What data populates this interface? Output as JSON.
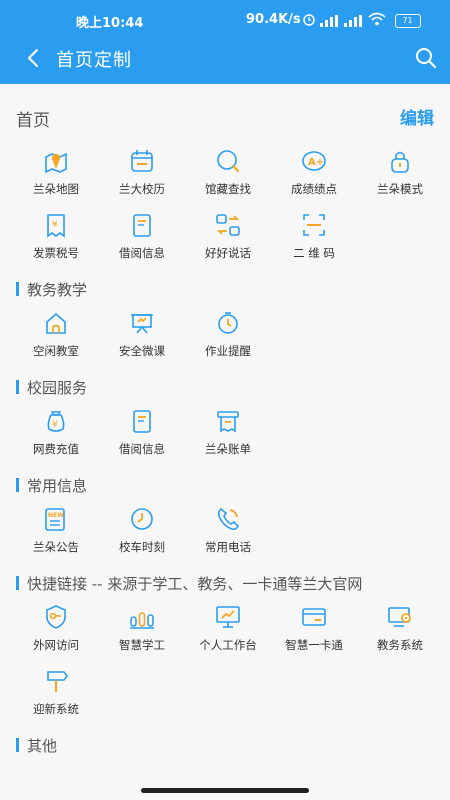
{
  "status_bar": {
    "time": "晚上10:44",
    "network_speed": "90.4K/s",
    "battery": "71"
  },
  "header": {
    "title": "首页定制"
  },
  "home": {
    "title": "首页",
    "edit_label": "编辑",
    "items": [
      {
        "label": "兰朵地图",
        "icon": "map-pin-icon"
      },
      {
        "label": "兰大校历",
        "icon": "calendar-icon"
      },
      {
        "label": "馆藏查找",
        "icon": "search-book-icon"
      },
      {
        "label": "成绩绩点",
        "icon": "grade-icon"
      },
      {
        "label": "兰朵模式",
        "icon": "lock-icon"
      },
      {
        "label": "发票税号",
        "icon": "invoice-icon"
      },
      {
        "label": "借阅信息",
        "icon": "book-icon"
      },
      {
        "label": "好好说话",
        "icon": "swap-icon"
      },
      {
        "label": "二 维 码",
        "icon": "qrcode-scan-icon"
      }
    ]
  },
  "sections": [
    {
      "title": "教务教学",
      "items": [
        {
          "label": "空闲教室",
          "icon": "classroom-icon"
        },
        {
          "label": "安全微课",
          "icon": "lecture-icon"
        },
        {
          "label": "作业提醒",
          "icon": "timer-icon"
        }
      ]
    },
    {
      "title": "校园服务",
      "items": [
        {
          "label": "网费充值",
          "icon": "money-bag-icon"
        },
        {
          "label": "借阅信息",
          "icon": "book-icon"
        },
        {
          "label": "兰朵账单",
          "icon": "bill-icon"
        }
      ]
    },
    {
      "title": "常用信息",
      "items": [
        {
          "label": "兰朵公告",
          "icon": "news-icon"
        },
        {
          "label": "校车时刻",
          "icon": "clock-icon"
        },
        {
          "label": "常用电话",
          "icon": "phone-icon"
        }
      ]
    },
    {
      "title": "快捷链接 -- 来源于学工、教务、一卡通等兰大官网",
      "items": [
        {
          "label": "外网访问",
          "icon": "key-shield-icon"
        },
        {
          "label": "智慧学工",
          "icon": "bars-icon"
        },
        {
          "label": "个人工作台",
          "icon": "monitor-icon"
        },
        {
          "label": "智慧一卡通",
          "icon": "card-icon"
        },
        {
          "label": "教务系统",
          "icon": "system-gear-icon"
        },
        {
          "label": "迎新系统",
          "icon": "signpost-icon"
        }
      ]
    },
    {
      "title": "其他",
      "items": []
    }
  ],
  "colors": {
    "accent": "#2b9df0",
    "icon_accent": "#f5a623"
  }
}
